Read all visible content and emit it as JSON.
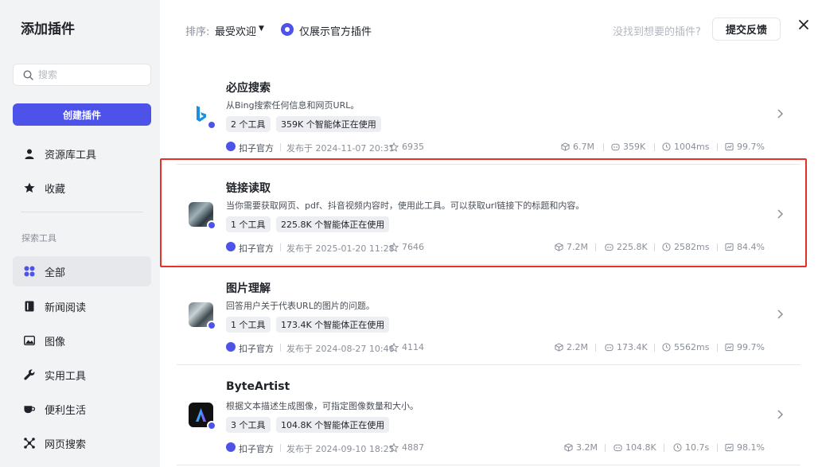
{
  "sidebar": {
    "title": "添加插件",
    "search_placeholder": "搜索",
    "create_label": "创建插件",
    "items": [
      {
        "label": "资源库工具",
        "icon": "person-icon"
      },
      {
        "label": "收藏",
        "icon": "star-icon"
      }
    ],
    "section_label": "探索工具",
    "categories": [
      {
        "label": "全部",
        "icon": "grid-icon",
        "active": true
      },
      {
        "label": "新闻阅读",
        "icon": "book-icon"
      },
      {
        "label": "图像",
        "icon": "image-icon"
      },
      {
        "label": "实用工具",
        "icon": "wrench-icon"
      },
      {
        "label": "便利生活",
        "icon": "cup-icon"
      },
      {
        "label": "网页搜索",
        "icon": "network-icon"
      }
    ]
  },
  "header": {
    "sort_label": "排序:",
    "sort_value": "最受欢迎",
    "official_only_label": "仅展示官方插件",
    "not_found_text": "没找到想要的插件?",
    "feedback_label": "提交反馈"
  },
  "plugins": [
    {
      "name": "必应搜索",
      "desc": "从Bing搜索任何信息和网页URL。",
      "tools": "2 个工具",
      "agents": "359K 个智能体正在使用",
      "author": "扣子官方",
      "date": "发布于 2024-11-07 20:31",
      "stars": "6935",
      "calls": "6.7M",
      "users": "359K",
      "latency": "1004ms",
      "success": "99.7%"
    },
    {
      "name": "链接读取",
      "desc": "当你需要获取网页、pdf、抖音视频内容时，使用此工具。可以获取url链接下的标题和内容。",
      "tools": "1 个工具",
      "agents": "225.8K 个智能体正在使用",
      "author": "扣子官方",
      "date": "发布于 2025-01-20 11:28",
      "stars": "7646",
      "calls": "7.2M",
      "users": "225.8K",
      "latency": "2582ms",
      "success": "84.4%"
    },
    {
      "name": "图片理解",
      "desc": "回答用户关于代表URL的图片的问题。",
      "tools": "1 个工具",
      "agents": "173.4K 个智能体正在使用",
      "author": "扣子官方",
      "date": "发布于 2024-08-27 10:46",
      "stars": "4114",
      "calls": "2.2M",
      "users": "173.4K",
      "latency": "5562ms",
      "success": "99.7%"
    },
    {
      "name": "ByteArtist",
      "desc": "根据文本描述生成图像，可指定图像数量和大小。",
      "tools": "3 个工具",
      "agents": "104.8K 个智能体正在使用",
      "author": "扣子官方",
      "date": "发布于 2024-09-10 18:25",
      "stars": "4887",
      "calls": "3.2M",
      "users": "104.8K",
      "latency": "10.7s",
      "success": "98.1%"
    }
  ],
  "colors": {
    "accent": "#4d53e8",
    "highlight": "#e8302b"
  }
}
